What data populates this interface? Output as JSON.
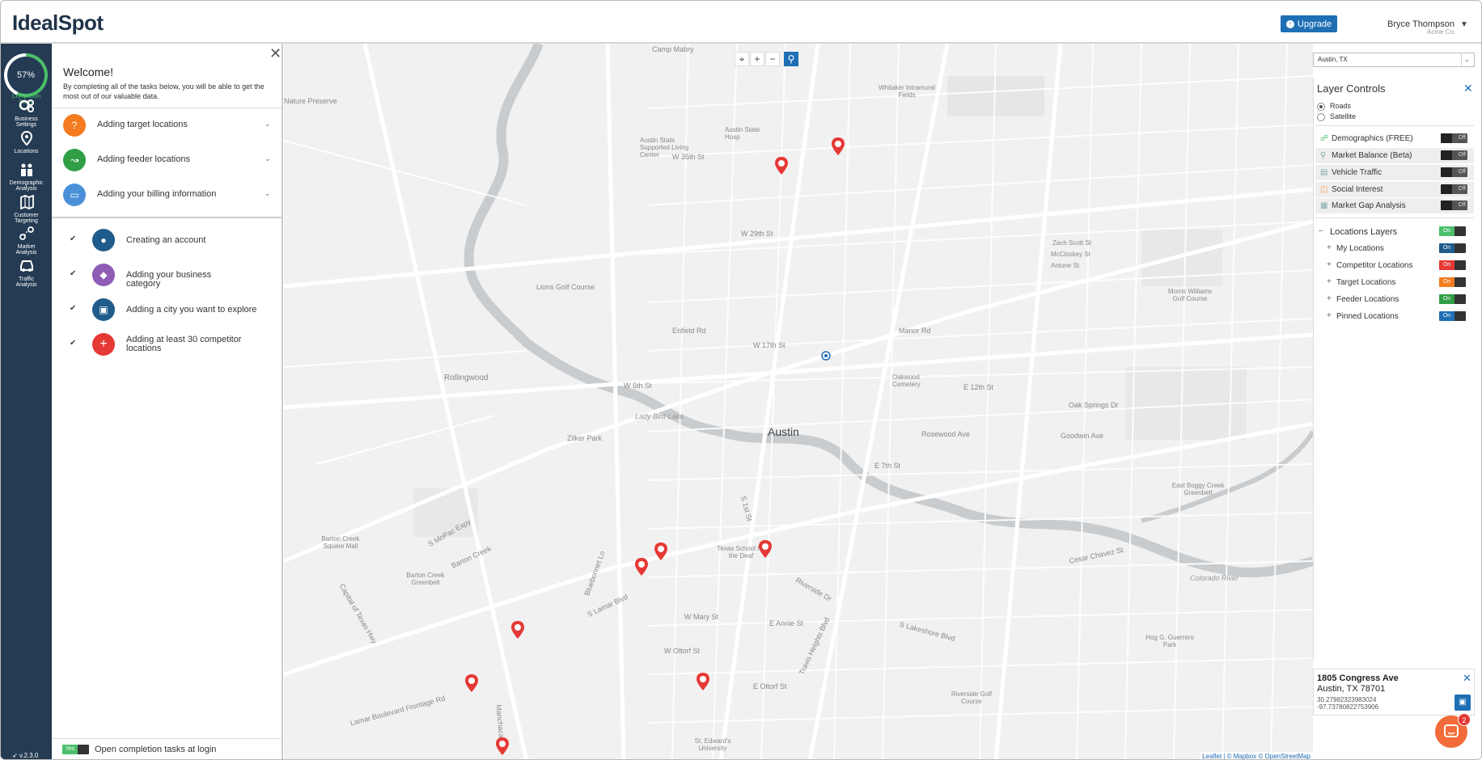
{
  "header": {
    "logo_text": "IdealSpot",
    "upgrade_label": "Upgrade",
    "user_name": "Bryce Thompson",
    "user_org": "Acme Co."
  },
  "leftnav": {
    "score_value": "57%",
    "score_label_1": "Completion",
    "score_label_2": "Score",
    "items": [
      {
        "line1": "Business",
        "line2": "Settings",
        "icon": "gears-icon"
      },
      {
        "line1": "Locations",
        "line2": "",
        "icon": "location-pin-icon"
      },
      {
        "line1": "Demographic",
        "line2": "Analysis",
        "icon": "people-icon"
      },
      {
        "line1": "Customer",
        "line2": "Targeting",
        "icon": "map-target-icon"
      },
      {
        "line1": "Market",
        "line2": "Analysis",
        "icon": "route-icon"
      },
      {
        "line1": "Traffic",
        "line2": "Analysis",
        "icon": "car-icon"
      }
    ],
    "version": "v.2.3.0"
  },
  "tasks": {
    "welcome_title": "Welcome!",
    "welcome_desc": "By completing all of the tasks below, you will be able to get the most out of our valuable data.",
    "pending": [
      {
        "label": "Adding target locations",
        "color": "#f47b20",
        "icon": "question-icon"
      },
      {
        "label": "Adding feeder locations",
        "color": "#2f9e44",
        "icon": "feeder-icon"
      },
      {
        "label": "Adding your billing information",
        "color": "#4a90d9",
        "icon": "credit-card-icon"
      }
    ],
    "done": [
      {
        "label": "Creating an account",
        "color": "#1f5c8c",
        "icon": "user-icon"
      },
      {
        "label": "Adding your business category",
        "color": "#8e5bb5",
        "icon": "tag-icon"
      },
      {
        "label": "Adding a city you want to explore",
        "color": "#1f5c8c",
        "icon": "clipboard-icon"
      },
      {
        "label": "Adding at least 30 competitor locations",
        "color": "#e53935",
        "icon": "plus-icon"
      }
    ],
    "footer_toggle_label": "Yes",
    "footer_label": "Open completion tasks at login"
  },
  "map": {
    "city_label": "Austin",
    "labels": [
      "Camp Mabry",
      "Nature Preserve",
      "W 35th St",
      "Austin State Supported Living Center",
      "Austin State Hosp",
      "Whitaker Intramural Fields",
      "W 29th St",
      "Lions Golf Course",
      "Enfield Rd",
      "W 17th St",
      "Rollingwood",
      "Zilker Park",
      "Lady Bird Lake",
      "W 5th St",
      "E 7th St",
      "Oakwood Cemetery",
      "Zach Scott St",
      "McCloskey St",
      "Antone St",
      "Morris Williams Golf Course",
      "Manor Rd",
      "Rosewood Ave",
      "Oak Springs Dr",
      "E 12th St",
      "Goodwin Ave",
      "East Boggy Creek Greenbelt",
      "Barton Creek Square Mall",
      "Barton Creek Greenbelt",
      "S MoPac Expy",
      "Barton Creek",
      "S Lamar Blvd",
      "Texas School for the Deaf",
      "Bluebonnet Ln",
      "W Mary St",
      "E Annie St",
      "W Oltorf St",
      "E Oltorf St",
      "Riverside Dr",
      "Colorado River",
      "Cesar Chavez St",
      "Hog G. Guerrero Park",
      "Riverside Golf Course",
      "St. Edward's University",
      "Lamar Boulevard Frontage Rd",
      "S Lakeshore Blvd",
      "Travis Heights Blvd",
      "Capital of Texas Hwy",
      "S 1st St",
      "Manchaca Rd"
    ],
    "attribution": "Leaflet | © Mapbox © OpenStreetMap"
  },
  "layer_controls": {
    "city_select_value": "Austin, TX",
    "title": "Layer Controls",
    "base_layers": [
      {
        "label": "Roads",
        "selected": true
      },
      {
        "label": "Satellite",
        "selected": false
      }
    ],
    "overlays": [
      {
        "label": "Demographics (FREE)",
        "state": "Off",
        "locked": false,
        "icon": "people-outline-icon"
      },
      {
        "label": "Market Balance (Beta)",
        "state": "Off",
        "locked": true,
        "icon": "pin-icon"
      },
      {
        "label": "Vehicle Traffic",
        "state": "Off",
        "locked": true,
        "icon": "car-icon"
      },
      {
        "label": "Social Interest",
        "state": "Off",
        "locked": true,
        "icon": "social-icon"
      },
      {
        "label": "Market Gap Analysis",
        "state": "Off",
        "locked": true,
        "icon": "gap-icon"
      }
    ],
    "locations_group": {
      "label": "Locations Layers",
      "state": "On",
      "color": "#4cbf6a"
    },
    "location_layers": [
      {
        "label": "My Locations",
        "state": "On",
        "color": "#1f5c8c"
      },
      {
        "label": "Competitor Locations",
        "state": "On",
        "color": "#e53935"
      },
      {
        "label": "Target Locations",
        "state": "On",
        "color": "#f47b20"
      },
      {
        "label": "Feeder Locations",
        "state": "On",
        "color": "#2f9e44"
      },
      {
        "label": "Pinned Locations",
        "state": "On",
        "color": "#1f6fb5"
      }
    ]
  },
  "address_card": {
    "street": "1805 Congress Ave",
    "city": "Austin, TX 78701",
    "lat": "30.27982323983024",
    "lng": "-97.73780822753906"
  },
  "chat_badge_count": "2",
  "colors": {
    "nav_bg": "#243b53",
    "accent": "#1f6fb5",
    "competitor_marker": "#e53935"
  }
}
